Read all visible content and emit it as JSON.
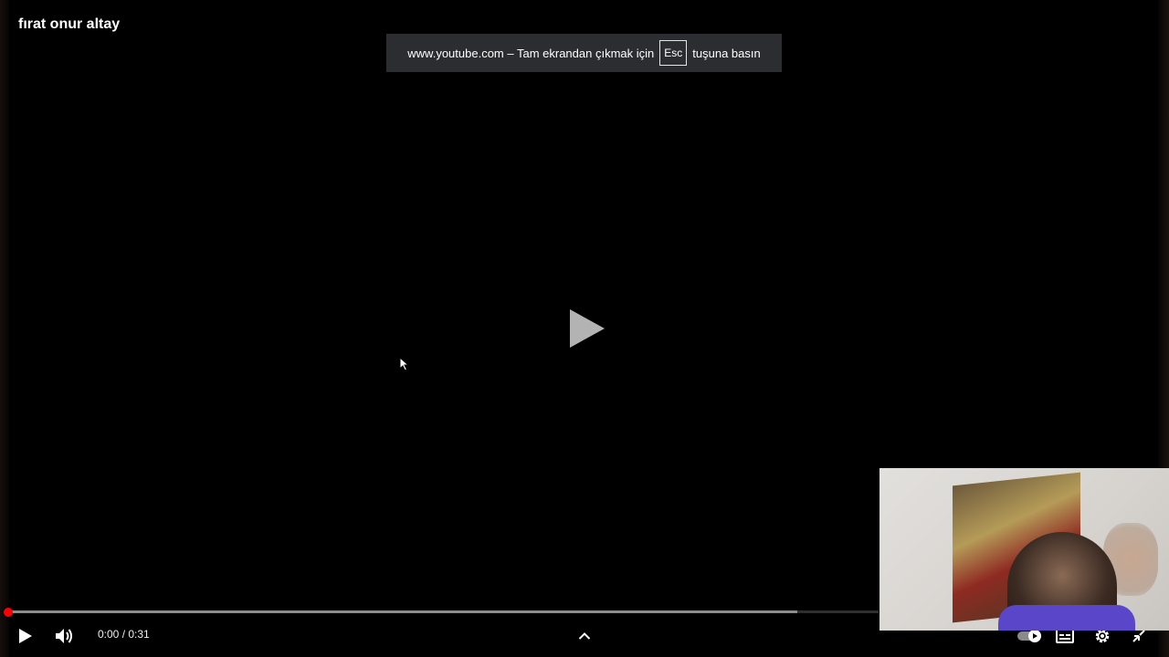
{
  "video": {
    "title": "fırat onur altay",
    "current_time": "0:00",
    "separator": " / ",
    "duration": "0:31",
    "progress_fraction": 0.0,
    "loaded_fraction": 0.907
  },
  "fullscreen_notice": {
    "text_before": "www.youtube.com – Tam ekrandan çıkmak için",
    "key_label": "Esc",
    "text_after": "tuşuna basın"
  },
  "controls": {
    "play_icon": "play-icon",
    "volume_icon": "volume-icon",
    "chevron_icon": "chevron-up-icon",
    "autoplay_icon": "autoplay-toggle-icon",
    "subtitles_icon": "subtitles-icon",
    "settings_icon": "gear-icon",
    "exit_fullscreen_icon": "exit-fullscreen-icon"
  },
  "colors": {
    "progress_accent": "#ff0000",
    "notice_background": "#2b2d30"
  }
}
